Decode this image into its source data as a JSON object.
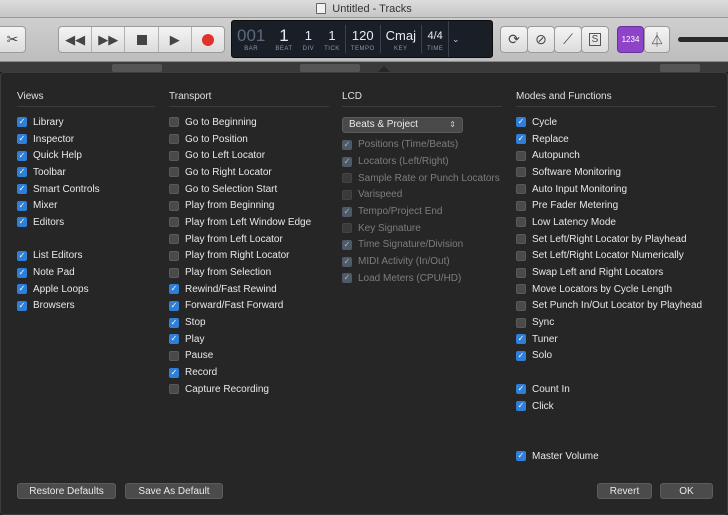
{
  "window": {
    "title": "Untitled - Tracks"
  },
  "lcd": {
    "bar_value": "001",
    "bar_label": "BAR",
    "beat_value": "1",
    "beat_label": "BEAT",
    "div_value": "1",
    "div_label": "DIV",
    "tick_value": "1",
    "tick_label": "TICK",
    "tempo_value": "120",
    "tempo_label": "TEMPO",
    "key_value": "Cmaj",
    "key_label": "KEY",
    "time_value": "4/4",
    "time_label": "TIME"
  },
  "toolbar": {
    "count_in_label": "1234"
  },
  "views": {
    "title": "Views",
    "group1": [
      {
        "label": "Library",
        "checked": true
      },
      {
        "label": "Inspector",
        "checked": true
      },
      {
        "label": "Quick Help",
        "checked": true
      },
      {
        "label": "Toolbar",
        "checked": true
      },
      {
        "label": "Smart Controls",
        "checked": true
      },
      {
        "label": "Mixer",
        "checked": true
      },
      {
        "label": "Editors",
        "checked": true
      }
    ],
    "group2": [
      {
        "label": "List Editors",
        "checked": true
      },
      {
        "label": "Note Pad",
        "checked": true
      },
      {
        "label": "Apple Loops",
        "checked": true
      },
      {
        "label": "Browsers",
        "checked": true
      }
    ]
  },
  "transport": {
    "title": "Transport",
    "items": [
      {
        "label": "Go to Beginning",
        "checked": false
      },
      {
        "label": "Go to Position",
        "checked": false
      },
      {
        "label": "Go to Left Locator",
        "checked": false
      },
      {
        "label": "Go to Right Locator",
        "checked": false
      },
      {
        "label": "Go to Selection Start",
        "checked": false
      },
      {
        "label": "Play from Beginning",
        "checked": false
      },
      {
        "label": "Play from Left Window Edge",
        "checked": false
      },
      {
        "label": "Play from Left Locator",
        "checked": false
      },
      {
        "label": "Play from Right Locator",
        "checked": false
      },
      {
        "label": "Play from Selection",
        "checked": false
      },
      {
        "label": "Rewind/Fast Rewind",
        "checked": true
      },
      {
        "label": "Forward/Fast Forward",
        "checked": true
      },
      {
        "label": "Stop",
        "checked": true
      },
      {
        "label": "Play",
        "checked": true
      },
      {
        "label": "Pause",
        "checked": false
      },
      {
        "label": "Record",
        "checked": true
      },
      {
        "label": "Capture Recording",
        "checked": false
      }
    ]
  },
  "lcd_settings": {
    "title": "LCD",
    "mode_selected": "Beats & Project",
    "items": [
      {
        "label": "Positions (Time/Beats)",
        "checked": true
      },
      {
        "label": "Locators (Left/Right)",
        "checked": true
      },
      {
        "label": "Sample Rate or Punch Locators",
        "checked": false
      },
      {
        "label": "Varispeed",
        "checked": false
      },
      {
        "label": "Tempo/Project End",
        "checked": true
      },
      {
        "label": "Key Signature",
        "checked": false
      },
      {
        "label": "Time Signature/Division",
        "checked": true
      },
      {
        "label": "MIDI Activity (In/Out)",
        "checked": true
      },
      {
        "label": "Load Meters (CPU/HD)",
        "checked": true
      }
    ]
  },
  "modes": {
    "title": "Modes and Functions",
    "group1": [
      {
        "label": "Cycle",
        "checked": true
      },
      {
        "label": "Replace",
        "checked": true
      },
      {
        "label": "Autopunch",
        "checked": false
      },
      {
        "label": "Software Monitoring",
        "checked": false
      },
      {
        "label": "Auto Input Monitoring",
        "checked": false
      },
      {
        "label": "Pre Fader Metering",
        "checked": false
      },
      {
        "label": "Low Latency Mode",
        "checked": false
      },
      {
        "label": "Set Left/Right Locator by Playhead",
        "checked": false
      },
      {
        "label": "Set Left/Right Locator Numerically",
        "checked": false
      },
      {
        "label": "Swap Left and Right Locators",
        "checked": false
      },
      {
        "label": "Move Locators by Cycle Length",
        "checked": false
      },
      {
        "label": "Set Punch In/Out Locator by Playhead",
        "checked": false
      },
      {
        "label": "Sync",
        "checked": false
      },
      {
        "label": "Tuner",
        "checked": true
      },
      {
        "label": "Solo",
        "checked": true
      }
    ],
    "group2": [
      {
        "label": "Count In",
        "checked": true
      },
      {
        "label": "Click",
        "checked": true
      }
    ],
    "group3": [
      {
        "label": "Master Volume",
        "checked": true
      }
    ]
  },
  "buttons": {
    "restore_defaults": "Restore Defaults",
    "save_as_default": "Save As Default",
    "revert": "Revert",
    "ok": "OK"
  }
}
